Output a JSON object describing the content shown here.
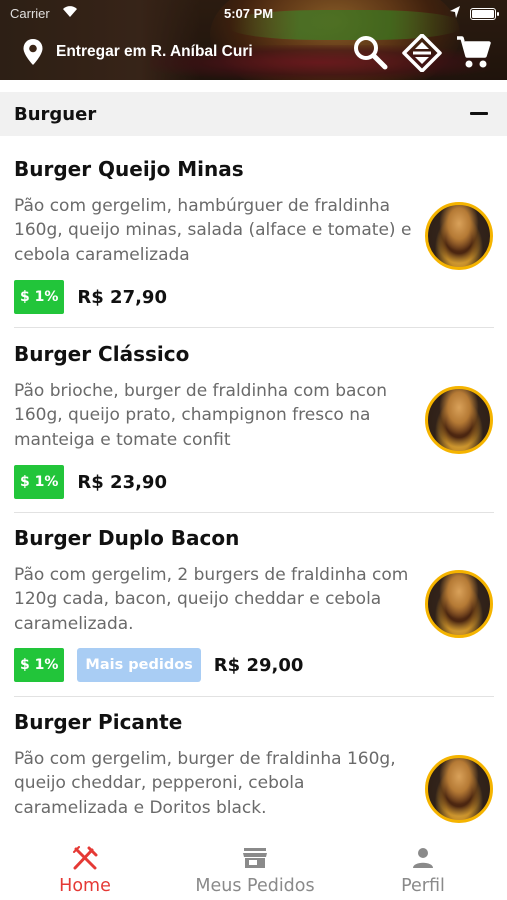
{
  "status_bar": {
    "carrier": "Carrier",
    "time": "5:07 PM"
  },
  "header": {
    "delivery_text": "Entregar em R. Aníbal Curi",
    "icons": [
      "location-pin-icon",
      "search-icon",
      "sort-icon",
      "cart-icon"
    ]
  },
  "category": {
    "title": "Burguer",
    "collapse_symbol": "−"
  },
  "items": [
    {
      "name": "Burger Queijo Minas",
      "description": "Pão com gergelim, hambúrguer de fraldinha 160g, queijo minas, salada (alface e tomate) e cebola caramelizada",
      "cashback": "$ 1%",
      "badge": "",
      "price": "R$ 27,90"
    },
    {
      "name": "Burger Clássico",
      "description": "Pão brioche, burger de fraldinha com bacon 160g, queijo prato, champignon fresco na manteiga e tomate confit",
      "cashback": "$ 1%",
      "badge": "",
      "price": "R$ 23,90"
    },
    {
      "name": "Burger Duplo Bacon",
      "description": "Pão com gergelim, 2 burgers de fraldinha com 120g cada, bacon, queijo cheddar e cebola caramelizada.",
      "cashback": "$ 1%",
      "badge": "Mais pedidos",
      "price": "R$ 29,00"
    },
    {
      "name": "Burger Picante",
      "description": "Pão com gergelim, burger de fraldinha 160g, queijo cheddar, pepperoni, cebola caramelizada e Doritos black.",
      "cashback": "",
      "badge": "",
      "price": ""
    }
  ],
  "tabbar": {
    "tabs": [
      {
        "label": "Home",
        "icon": "cutlery-icon",
        "active": true
      },
      {
        "label": "Meus Pedidos",
        "icon": "store-icon",
        "active": false
      },
      {
        "label": "Perfil",
        "icon": "person-icon",
        "active": false
      }
    ]
  },
  "colors": {
    "accent": "#e53935",
    "cashback": "#22c53a",
    "popular_badge": "#a9cdf4",
    "thumb_border": "#f5b400",
    "category_bg": "#f1f1f1"
  }
}
